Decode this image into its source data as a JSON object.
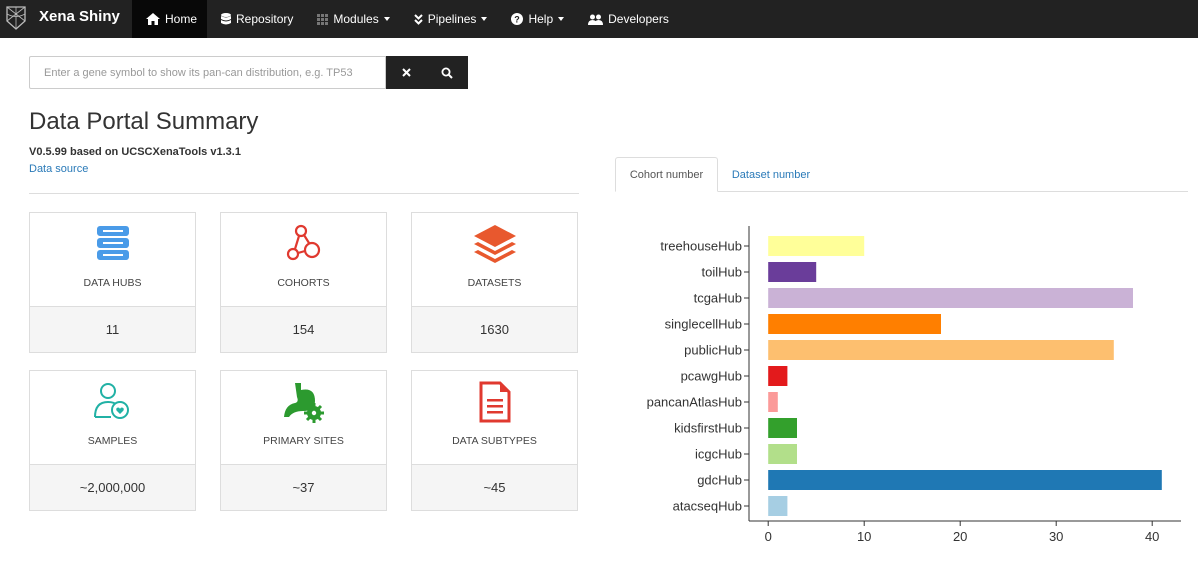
{
  "navbar": {
    "brand": "Xena Shiny",
    "items": [
      {
        "label": "Home",
        "icon": "home-icon",
        "active": true,
        "dropdown": false
      },
      {
        "label": "Repository",
        "icon": "database-icon",
        "active": false,
        "dropdown": false
      },
      {
        "label": "Modules",
        "icon": "grid-icon",
        "active": false,
        "dropdown": true
      },
      {
        "label": "Pipelines",
        "icon": "angle-double-down-icon",
        "active": false,
        "dropdown": true
      },
      {
        "label": "Help",
        "icon": "question-circle-icon",
        "active": false,
        "dropdown": true
      },
      {
        "label": "Developers",
        "icon": "users-icon",
        "active": false,
        "dropdown": false
      }
    ]
  },
  "search": {
    "placeholder": "Enter a gene symbol to show its pan-can distribution, e.g. TP53",
    "value": ""
  },
  "summary": {
    "title": "Data Portal Summary",
    "version": "V0.5.99 based on UCSCXenaTools v1.3.1",
    "data_source_link": "Data source"
  },
  "cards": [
    {
      "label": "DATA HUBS",
      "value": "11",
      "icon": "server-stack-icon",
      "color": "#4a9be8"
    },
    {
      "label": "COHORTS",
      "value": "154",
      "icon": "connected-nodes-icon",
      "color": "#e0392f"
    },
    {
      "label": "DATASETS",
      "value": "1630",
      "icon": "layers-icon",
      "color": "#e8582e"
    },
    {
      "label": "SAMPLES",
      "value": "~2,000,000",
      "icon": "user-heart-icon",
      "color": "#21b1a5"
    },
    {
      "label": "PRIMARY SITES",
      "value": "~37",
      "icon": "stomach-gear-icon",
      "color": "#2c9a2f"
    },
    {
      "label": "DATA SUBTYPES",
      "value": "~45",
      "icon": "document-icon",
      "color": "#e0392f"
    }
  ],
  "tabs": [
    {
      "label": "Cohort number",
      "active": true
    },
    {
      "label": "Dataset number",
      "active": false
    }
  ],
  "chart_data": {
    "type": "bar",
    "orientation": "horizontal",
    "categories": [
      "treehouseHub",
      "toilHub",
      "tcgaHub",
      "singlecellHub",
      "publicHub",
      "pcawgHub",
      "pancanAtlasHub",
      "kidsfirstHub",
      "icgcHub",
      "gdcHub",
      "atacseqHub"
    ],
    "values": [
      10,
      5,
      38,
      18,
      36,
      2,
      1,
      3,
      3,
      41,
      2
    ],
    "colors": [
      "#ffff99",
      "#6a3d9a",
      "#cab2d6",
      "#ff7f00",
      "#fdbf6f",
      "#e31a1c",
      "#fb9a99",
      "#33a02c",
      "#b2df8a",
      "#1f78b4",
      "#a6cee3"
    ],
    "xticks": [
      0,
      10,
      20,
      30,
      40
    ],
    "xlim": [
      -2,
      43
    ],
    "grid": false,
    "legend": false
  }
}
